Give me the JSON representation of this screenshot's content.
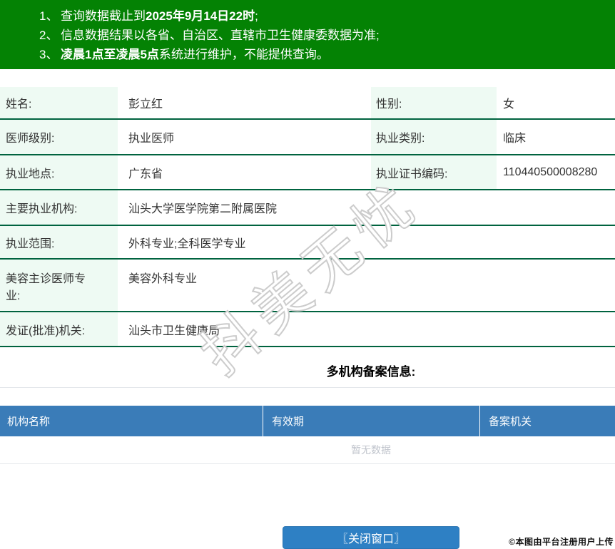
{
  "banner": {
    "bg_color": "#048204",
    "notices": [
      {
        "num": "1、",
        "pre": "查询数据截止到",
        "bold": "2025年9月14日22时",
        "post": ";"
      },
      {
        "num": "2、",
        "pre": "信息数据结果以各省、自治区、直辖市卫生健康委数据为准;",
        "bold": "",
        "post": ""
      },
      {
        "num": "3、",
        "pre": "",
        "bold": "凌晨1点至凌晨5点",
        "post": "系统进行维护，不能提供查询。"
      }
    ]
  },
  "doctor": {
    "name_label": "姓名:",
    "name": "彭立红",
    "gender_label": "性别:",
    "gender": "女",
    "level_label": "医师级别:",
    "level": "执业医师",
    "category_label": "执业类别:",
    "category": "临床",
    "location_label": "执业地点:",
    "location": "广东省",
    "cert_no_label": "执业证书编码:",
    "cert_no": "110440500008280",
    "main_org_label": "主要执业机构:",
    "main_org": "汕头大学医学院第二附属医院",
    "scope_label": "执业范围:",
    "scope": "外科专业;全科医学专业",
    "cosmetic_label": "美容主诊医师专业:",
    "cosmetic": "美容外科专业",
    "issuer_label": "发证(批准)机关:",
    "issuer": "汕头市卫生健康局"
  },
  "records": {
    "section_title": "多机构备案信息:",
    "headers": [
      "机构名称",
      "有效期",
      "备案机关"
    ],
    "empty_text": "暂无数据",
    "header_bg": "#3a7cb8"
  },
  "footer": {
    "close_button": "〖关闭窗口〗",
    "corner_note": "©本图由平台注册用户上传",
    "button_color": "#2e80c4"
  },
  "watermark_text": "抖美无忧",
  "colors": {
    "row_line": "#00633f",
    "label_bg": "#eefaf3",
    "empty_text": "#c0c4cc"
  }
}
